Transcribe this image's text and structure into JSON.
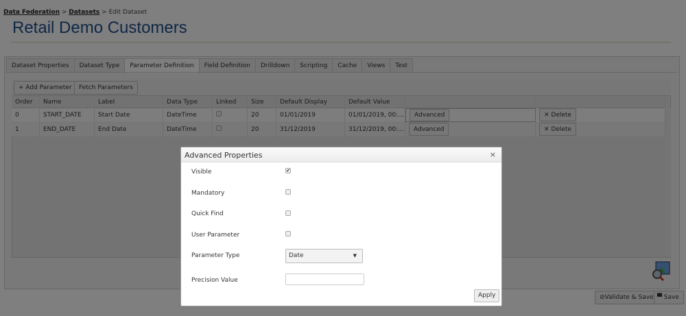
{
  "breadcrumb": {
    "items": [
      "Data Federation",
      "Datasets"
    ],
    "current": "Edit Dataset",
    "sep": " > "
  },
  "page_title": "Retail Demo Customers",
  "tabs": [
    "Dataset Properties",
    "Dataset Type",
    "Parameter Definition",
    "Field Definition",
    "Drilldown",
    "Scripting",
    "Cache",
    "Views",
    "Test"
  ],
  "active_tab": "Parameter Definition",
  "toolbar": {
    "add": "+ Add Parameter",
    "fetch": "Fetch Parameters"
  },
  "table": {
    "headers": [
      "Order",
      "Name",
      "Label",
      "Data Type",
      "Linked",
      "Size",
      "Default Display",
      "Default Value"
    ],
    "rows": [
      {
        "order": "0",
        "name": "START_DATE",
        "label": "Start Date",
        "type": "DateTime",
        "linked": false,
        "size": "20",
        "display": "01/01/2019",
        "value": "01/01/2019, 00:..."
      },
      {
        "order": "1",
        "name": "END_DATE",
        "label": "End Date",
        "type": "DateTime",
        "linked": false,
        "size": "20",
        "display": "31/12/2019",
        "value": "31/12/2019, 00:..."
      }
    ],
    "advanced": "Advanced",
    "delete": "✕ Delete"
  },
  "footer": {
    "validate": "⊘Validate & Save",
    "save": "Save"
  },
  "modal": {
    "title": "Advanced Properties",
    "close": "×",
    "fields": {
      "visible": {
        "label": "Visible",
        "checked": true
      },
      "mandatory": {
        "label": "Mandatory",
        "checked": false
      },
      "quick_find": {
        "label": "Quick Find",
        "checked": false
      },
      "user_parameter": {
        "label": "User Parameter",
        "checked": false
      }
    },
    "parameter_type": {
      "label": "Parameter Type",
      "value": "Date"
    },
    "precision": {
      "label": "Precision Value",
      "value": ""
    },
    "apply": "Apply"
  }
}
